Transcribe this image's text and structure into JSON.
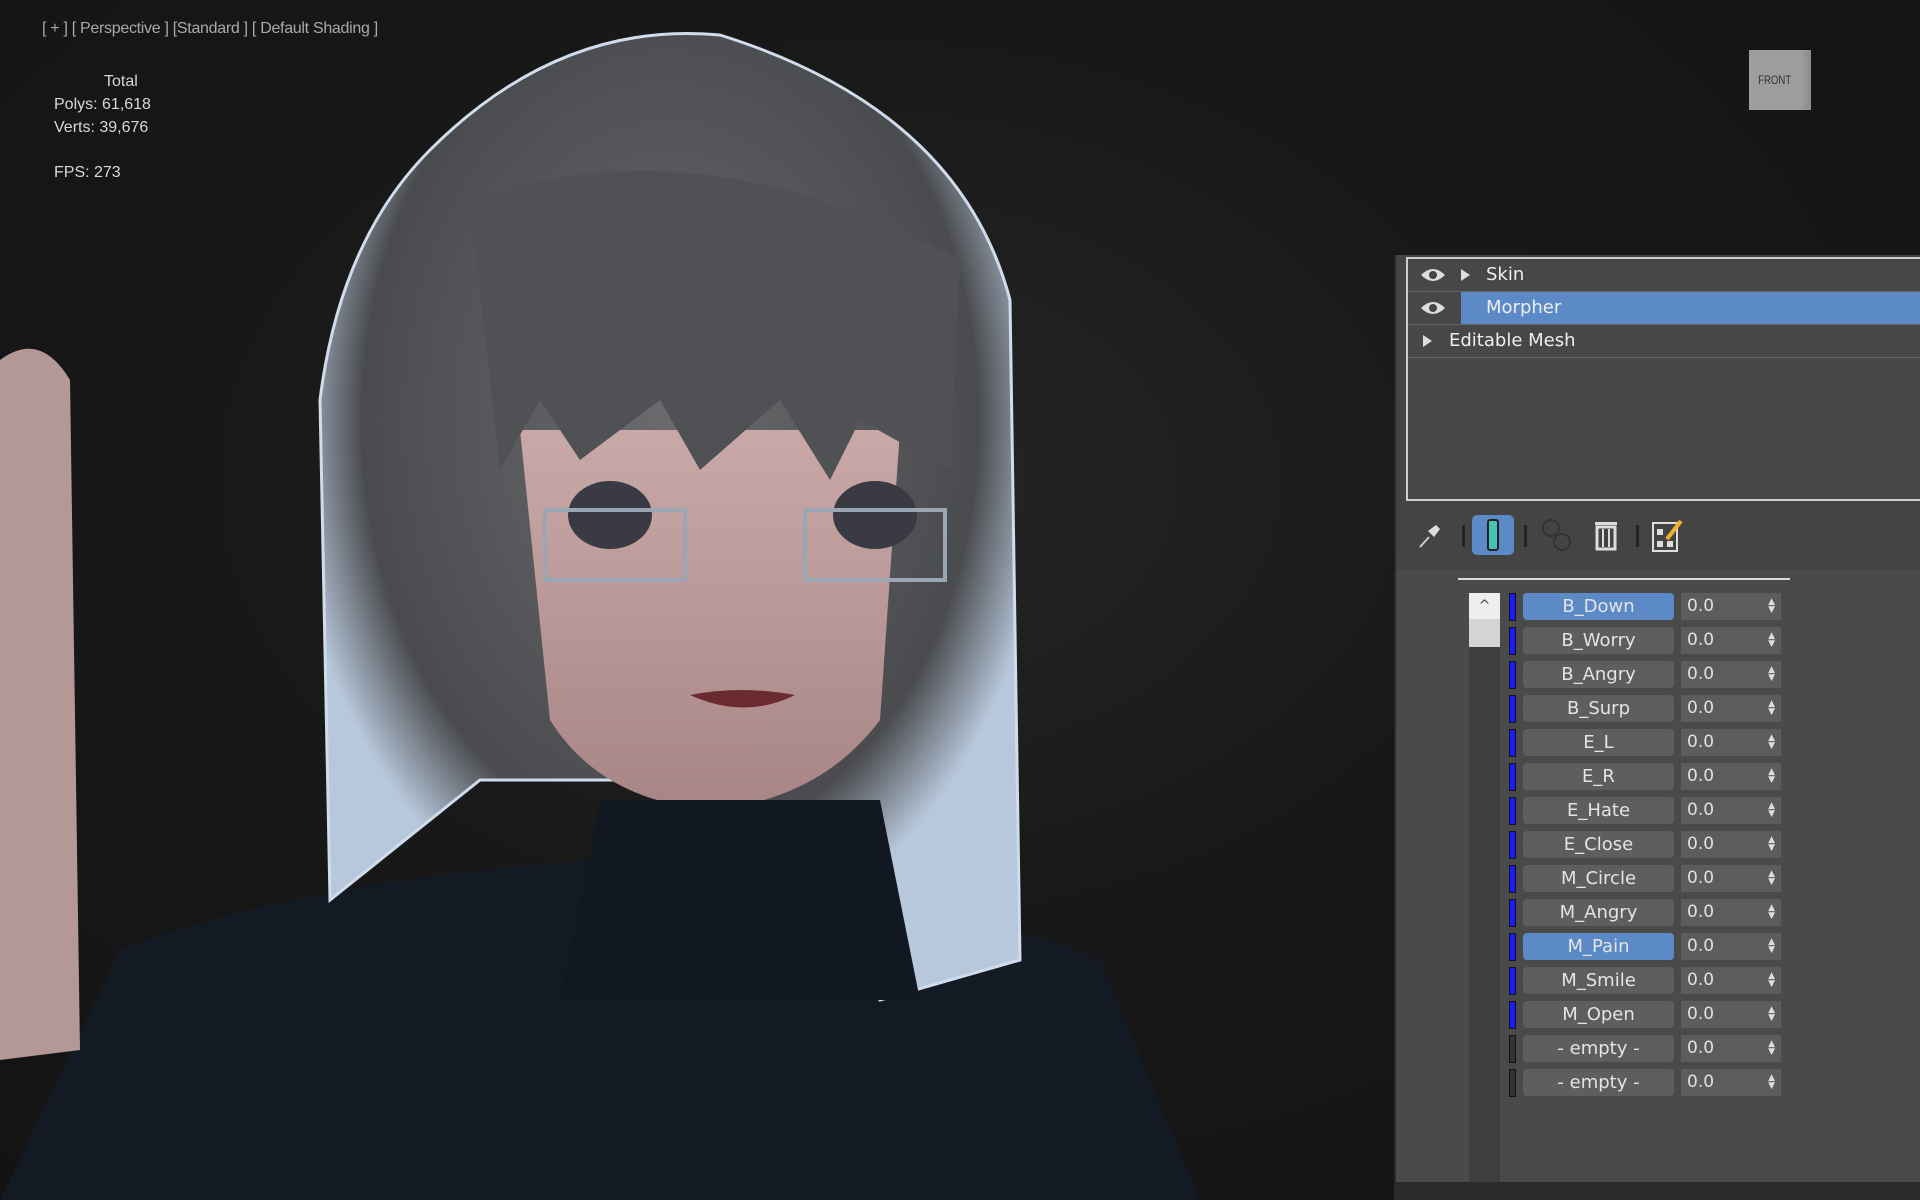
{
  "viewport": {
    "label": "[ + ] [ Perspective ] [Standard ] [ Default Shading ]",
    "stats": {
      "total_label": "Total",
      "polys": "Polys: 61,618",
      "verts": "Verts: 39,676",
      "fps": "FPS:  273"
    },
    "viewcube_label": "FRONT"
  },
  "modifier_stack": {
    "items": [
      {
        "label": "Skin",
        "selected": false
      },
      {
        "label": "Morpher",
        "selected": true
      },
      {
        "label": "Editable Mesh",
        "selected": false
      }
    ]
  },
  "toolbar": {
    "icons": [
      "pin-stack-icon",
      "show-end-result-icon",
      "make-unique-icon",
      "remove-modifier-icon",
      "configure-modifier-sets-icon"
    ]
  },
  "morpher": {
    "scroll_up": "^",
    "channels": [
      {
        "name": "B_Down",
        "value": "0.0",
        "selected": true,
        "empty": false
      },
      {
        "name": "B_Worry",
        "value": "0.0",
        "selected": false,
        "empty": false
      },
      {
        "name": "B_Angry",
        "value": "0.0",
        "selected": false,
        "empty": false
      },
      {
        "name": "B_Surp",
        "value": "0.0",
        "selected": false,
        "empty": false
      },
      {
        "name": "E_L",
        "value": "0.0",
        "selected": false,
        "empty": false
      },
      {
        "name": "E_R",
        "value": "0.0",
        "selected": false,
        "empty": false
      },
      {
        "name": "E_Hate",
        "value": "0.0",
        "selected": false,
        "empty": false
      },
      {
        "name": "E_Close",
        "value": "0.0",
        "selected": false,
        "empty": false
      },
      {
        "name": "M_Circle",
        "value": "0.0",
        "selected": false,
        "empty": false
      },
      {
        "name": "M_Angry",
        "value": "0.0",
        "selected": false,
        "empty": false
      },
      {
        "name": "M_Pain",
        "value": "0.0",
        "selected": true,
        "empty": false
      },
      {
        "name": "M_Smile",
        "value": "0.0",
        "selected": false,
        "empty": false
      },
      {
        "name": "M_Open",
        "value": "0.0",
        "selected": false,
        "empty": false
      },
      {
        "name": "- empty -",
        "value": "0.0",
        "selected": false,
        "empty": true
      },
      {
        "name": "- empty -",
        "value": "0.0",
        "selected": false,
        "empty": true
      }
    ]
  },
  "colors": {
    "selection": "#5b8ac6",
    "channel_active": "#1a1aff",
    "panel_bg": "#444444"
  }
}
